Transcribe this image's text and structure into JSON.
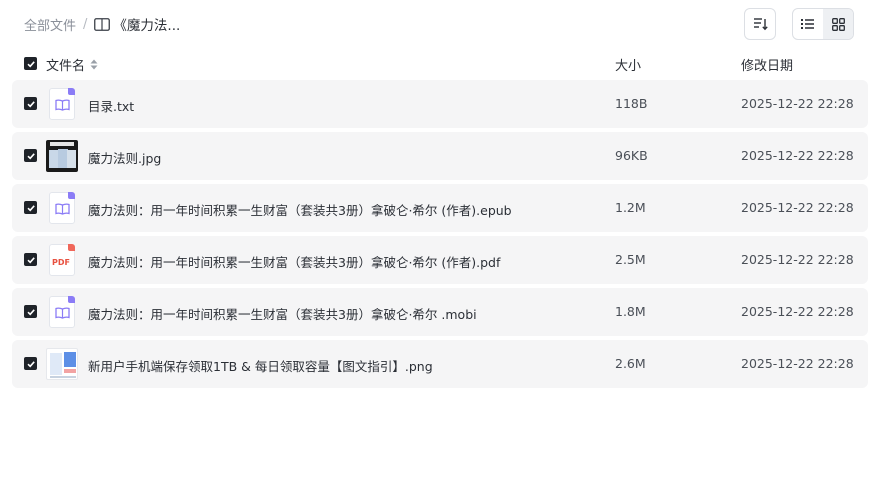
{
  "breadcrumb": {
    "root": "全部文件",
    "separator": "/",
    "current": "《魔力法..."
  },
  "toolbar": {
    "sort_icon": "sort-lines-icon",
    "view_list_icon": "list-view-icon",
    "view_grid_icon": "grid-view-icon",
    "active_view": "list"
  },
  "header": {
    "name": "文件名",
    "size": "大小",
    "date": "修改日期"
  },
  "files": [
    {
      "name": "目录.txt",
      "size": "118B",
      "date": "2025-12-22 22:28",
      "type": "txt"
    },
    {
      "name": "魔力法则.jpg",
      "size": "96KB",
      "date": "2025-12-22 22:28",
      "type": "jpg"
    },
    {
      "name": "魔力法则：用一年时间积累一生财富（套装共3册）拿破仑·希尔 (作者).epub",
      "size": "1.2M",
      "date": "2025-12-22 22:28",
      "type": "epub"
    },
    {
      "name": "魔力法则：用一年时间积累一生财富（套装共3册）拿破仑·希尔 (作者).pdf",
      "size": "2.5M",
      "date": "2025-12-22 22:28",
      "type": "pdf"
    },
    {
      "name": "魔力法则：用一年时间积累一生财富（套装共3册）拿破仑·希尔 .mobi",
      "size": "1.8M",
      "date": "2025-12-22 22:28",
      "type": "mobi"
    },
    {
      "name": "新用户手机端保存领取1TB & 每日领取容量【图文指引】.png",
      "size": "2.6M",
      "date": "2025-12-22 22:28",
      "type": "png"
    }
  ],
  "pdf_badge": "PDF",
  "colors": {
    "row_bg": "#f5f5f6",
    "checkbox": "#1f2329",
    "book_accent": "#8b7cf6",
    "pdf_accent": "#e8503f"
  }
}
